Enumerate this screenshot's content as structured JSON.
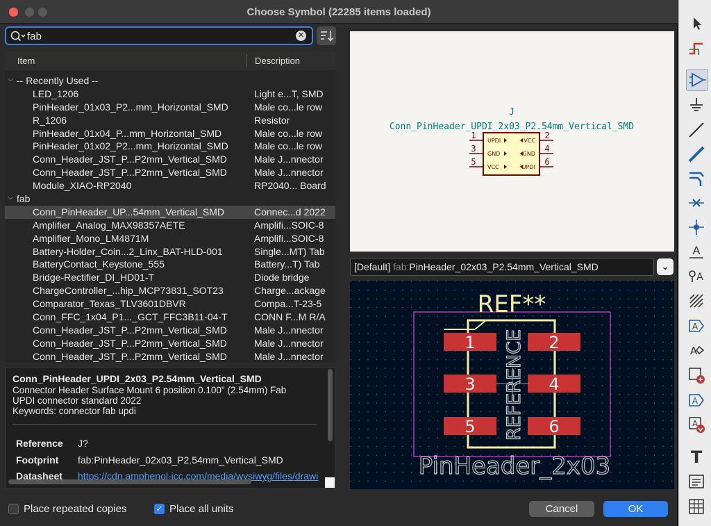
{
  "window": {
    "title": "Choose Symbol (22285 items loaded)"
  },
  "search": {
    "value": "fab"
  },
  "tree": {
    "columns": {
      "item": "Item",
      "description": "Description"
    },
    "rows": [
      {
        "type": "group",
        "name": "-- Recently Used --",
        "desc": ""
      },
      {
        "type": "item",
        "name": "LED_1206",
        "desc": "Light e...T, SMD"
      },
      {
        "type": "item",
        "name": "PinHeader_01x03_P2...mm_Horizontal_SMD",
        "desc": "Male co...le row"
      },
      {
        "type": "item",
        "name": "R_1206",
        "desc": "Resistor"
      },
      {
        "type": "item",
        "name": "PinHeader_01x04_P...mm_Horizontal_SMD",
        "desc": "Male co...le row"
      },
      {
        "type": "item",
        "name": "PinHeader_01x02_P2...mm_Horizontal_SMD",
        "desc": "Male co...le row"
      },
      {
        "type": "item",
        "name": "Conn_Header_JST_P...P2mm_Vertical_SMD",
        "desc": "Male J...nnector"
      },
      {
        "type": "item",
        "name": "Conn_Header_JST_P...P2mm_Vertical_SMD",
        "desc": "Male J...nnector"
      },
      {
        "type": "item",
        "name": "Module_XIAO-RP2040",
        "desc": "RP2040... Board"
      },
      {
        "type": "group",
        "name": "fab",
        "desc": ""
      },
      {
        "type": "item",
        "name": "Conn_PinHeader_UP...54mm_Vertical_SMD",
        "desc": "Connec...d 2022",
        "selected": true
      },
      {
        "type": "item",
        "name": "Amplifier_Analog_MAX98357AETE",
        "desc": "Amplifi...SOIC-8"
      },
      {
        "type": "item",
        "name": "Amplifier_Mono_LM4871M",
        "desc": "Amplifi...SOIC-8"
      },
      {
        "type": "item",
        "name": "Battery-Holder_Coin...2_Linx_BAT-HLD-001",
        "desc": "Single...MT) Tab"
      },
      {
        "type": "item",
        "name": "BatteryContact_Keystone_555",
        "desc": "Battery...T) Tab"
      },
      {
        "type": "item",
        "name": "Bridge-Rectifier_DI_HD01-T",
        "desc": "Diode bridge"
      },
      {
        "type": "item",
        "name": "ChargeController_...hip_MCP73831_SOT23",
        "desc": "Charge...ackage"
      },
      {
        "type": "item",
        "name": "Comparator_Texas_TLV3601DBVR",
        "desc": "Compa...T-23-5"
      },
      {
        "type": "item",
        "name": "Conn_FFC_1x04_P1..._GCT_FFC3B11-04-T",
        "desc": "CONN F...M R/A"
      },
      {
        "type": "item",
        "name": "Conn_Header_JST_P...P2mm_Vertical_SMD",
        "desc": "Male J...nnector"
      },
      {
        "type": "item",
        "name": "Conn_Header_JST_P...P2mm_Vertical_SMD",
        "desc": "Male J...nnector"
      },
      {
        "type": "item",
        "name": "Conn_Header_JST_P...P2mm_Vertical_SMD",
        "desc": "Male J...nnector"
      }
    ]
  },
  "details": {
    "title": "Conn_PinHeader_UPDI_2x03_P2.54mm_Vertical_SMD",
    "line1": "Connector Header Surface Mount 6 position 0.100\" (2.54mm) Fab",
    "line2": "UPDI connector standard 2022",
    "keywords": "Keywords: connector fab updi",
    "reference_label": "Reference",
    "reference_value": "J?",
    "footprint_label": "Footprint",
    "footprint_value": "fab:PinHeader_02x03_P2.54mm_Vertical_SMD",
    "datasheet_label": "Datasheet",
    "datasheet_value": "https://cdn.amphenol-icc.com/media/wysiwyg/files/drawi"
  },
  "symbol": {
    "ref": "J",
    "value": "Conn_PinHeader_UPDI_2x03_P2.54mm_Vertical_SMD",
    "pins_left": [
      {
        "num": "1",
        "name": "UPDI"
      },
      {
        "num": "3",
        "name": "GND"
      },
      {
        "num": "5",
        "name": "VCC"
      }
    ],
    "pins_right": [
      {
        "num": "2",
        "name": "VCC"
      },
      {
        "num": "4",
        "name": "GND"
      },
      {
        "num": "6",
        "name": "UPDI"
      }
    ]
  },
  "footprint_select": {
    "prefix": "[Default] ",
    "lib": "fab:",
    "name": "PinHeader_02x03_P2.54mm_Vertical_SMD"
  },
  "footprint": {
    "ref_text": "REF**",
    "ref_vertical": "REFERENCE",
    "value_text": "PinHeader_2x03",
    "pads": [
      "1",
      "2",
      "3",
      "4",
      "5",
      "6"
    ]
  },
  "options": {
    "place_repeated": {
      "label": "Place repeated copies",
      "checked": false
    },
    "place_all_units": {
      "label": "Place all units",
      "checked": true
    }
  },
  "buttons": {
    "cancel": "Cancel",
    "ok": "OK"
  },
  "colors": {
    "accent": "#2f7ff0",
    "schematic_line": "#840000",
    "schematic_text": "#007d7d",
    "pad": "#c83434",
    "courtyard": "#e040e0",
    "silkscreen": "#f2eda1"
  },
  "toolbar_icons": [
    "pointer-icon",
    "highlight-net-icon",
    "add-symbol-icon",
    "add-power-icon",
    "add-wire-icon",
    "add-bus-icon",
    "bus-entry-icon",
    "no-connect-icon",
    "junction-icon",
    "net-label-icon",
    "global-label-icon",
    "hierarchical-label-icon",
    "hierarchical-sheet-icon",
    "import-sheet-pin-icon",
    "sheet-pin-icon",
    "add-text-icon",
    "text-box-icon",
    "table-icon"
  ]
}
